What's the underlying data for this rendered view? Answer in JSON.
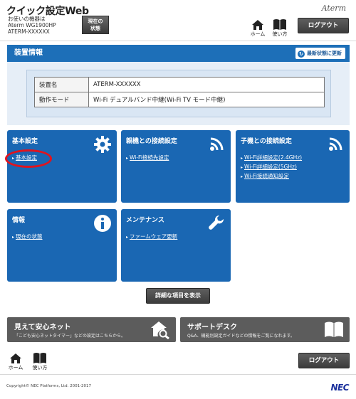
{
  "header": {
    "title": "クイック設定Web",
    "device_label": "お使いの機器は",
    "model": "Aterm WG1900HP",
    "device_name": "ATERM-XXXXXX",
    "status_button": "現在の状態",
    "brand": "Aterm",
    "home_label": "ホーム",
    "help_label": "使い方",
    "logout_label": "ログアウト"
  },
  "device_info": {
    "heading": "装置情報",
    "refresh_label": "最新状態に更新",
    "rows": [
      {
        "key": "装置名",
        "value": "ATERM-XXXXXX"
      },
      {
        "key": "動作モード",
        "value": "Wi-Fi デュアルバンド中継(Wi-Fi TV モード中継)"
      }
    ]
  },
  "tiles": {
    "basic": {
      "title": "基本設定",
      "links": [
        "基本設定"
      ],
      "icon": "gear-icon"
    },
    "parent": {
      "title": "親機との接続設定",
      "links": [
        "Wi-Fi接続先設定"
      ],
      "icon": "wifi-icon"
    },
    "child": {
      "title": "子機との接続設定",
      "links": [
        "Wi-Fi詳細設定(2.4GHz)",
        "Wi-Fi詳細設定(5GHz)",
        "Wi-Fi接続通知設定"
      ],
      "icon": "wifi-icon"
    },
    "info": {
      "title": "情報",
      "links": [
        "現在の状態"
      ],
      "icon": "info-icon"
    },
    "maint": {
      "title": "メンテナンス",
      "links": [
        "ファームウェア更新"
      ],
      "icon": "wrench-icon"
    }
  },
  "detail_button": "詳細な項目を表示",
  "banners": {
    "safety": {
      "title": "見えて安心ネット",
      "desc": "「こども安心ネットタイマー」などの設定はこちらから。"
    },
    "support": {
      "title": "サポートデスク",
      "desc": "Q&A、機能別設定ガイドなどの情報をご覧になれます。"
    }
  },
  "footer": {
    "home_label": "ホーム",
    "help_label": "使い方",
    "logout_label": "ログアウト",
    "copyright": "Copyright© NEC Platforms, Ltd. 2001-2017",
    "logo": "NEC"
  },
  "colors": {
    "accent": "#1a67b3",
    "highlight": "#e0141e",
    "dark_button": "#4a4a4a"
  }
}
